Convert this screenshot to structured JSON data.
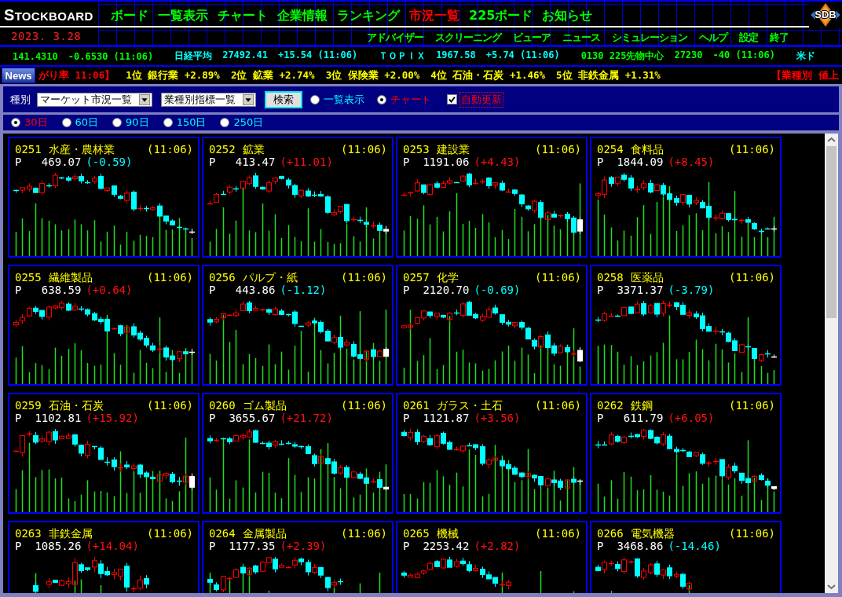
{
  "header": {
    "logo": "STOCKBOARD",
    "badge": "SDB",
    "date": "2023. 3.28",
    "nav": [
      {
        "label": "ボード",
        "selected": false
      },
      {
        "label": "一覧表示",
        "selected": false
      },
      {
        "label": "チャート",
        "selected": false
      },
      {
        "label": "企業情報",
        "selected": false
      },
      {
        "label": "ランキング",
        "selected": false
      },
      {
        "label": "市況一覧",
        "selected": true
      },
      {
        "label": "225ボード",
        "selected": false
      },
      {
        "label": "お知らせ",
        "selected": false
      }
    ],
    "subnav": [
      "アドバイザー",
      "スクリーニング",
      "ビューア",
      "ニュース",
      "シミュレーション",
      "ヘルプ",
      "設定",
      "終了"
    ]
  },
  "ticker": [
    {
      "value": "141.4310",
      "change": "-0.6530 (11:06)",
      "color": "#00ff00"
    },
    {
      "name": "日経平均",
      "value": "27492.41",
      "change": "+15.54 (11:06)",
      "color": "#00ffff"
    },
    {
      "name": "ＴＯＰＩＸ",
      "value": "1967.58",
      "change": "+5.74 (11:06)",
      "color": "#00ffff"
    },
    {
      "name": "0130 225先物中心",
      "value": "27230",
      "change": "-40 (11:06)",
      "color": "#00ff00"
    },
    {
      "name": "米ド",
      "color": "#00ffff"
    }
  ],
  "news": {
    "button": "News",
    "items": [
      {
        "kind": "heading",
        "text": "がり率 11:06】"
      },
      {
        "kind": "rank",
        "text": "1位 銀行業 +2.89%"
      },
      {
        "kind": "rank",
        "text": "2位 鉱業 +2.74%"
      },
      {
        "kind": "rank",
        "text": "3位 保険業 +2.00%"
      },
      {
        "kind": "rank",
        "text": "4位 石油・石炭 +1.46%"
      },
      {
        "kind": "rank",
        "text": "5位 非鉄金属 +1.31%"
      },
      {
        "kind": "heading",
        "text": "【業種別 値上"
      }
    ]
  },
  "controls": {
    "label": "種別",
    "selects": [
      {
        "value": "マーケット市況一覧"
      },
      {
        "value": "業種別指標一覧"
      }
    ],
    "search_button": "検索",
    "views": [
      {
        "label": "一覧表示",
        "selected": false
      },
      {
        "label": "チャート",
        "selected": true
      }
    ],
    "auto_update": {
      "label": "自動更新",
      "checked": true
    }
  },
  "periods": [
    {
      "label": "30日",
      "selected": true
    },
    {
      "label": "60日",
      "selected": false
    },
    {
      "label": "90日",
      "selected": false
    },
    {
      "label": "150日",
      "selected": false
    },
    {
      "label": "250日",
      "selected": false
    }
  ],
  "cards": [
    {
      "code": "0251",
      "name": "水産・農林業",
      "time": "(11:06)",
      "price_label": "P",
      "price": "469.07",
      "change": "(-0.59)",
      "rising": false
    },
    {
      "code": "0252",
      "name": "鉱業",
      "time": "(11:06)",
      "price_label": "P",
      "price": "413.47",
      "change": "(+11.01)",
      "rising": true
    },
    {
      "code": "0253",
      "name": "建設業",
      "time": "(11:06)",
      "price_label": "P",
      "price": "1191.06",
      "change": "(+4.43)",
      "rising": true
    },
    {
      "code": "0254",
      "name": "食料品",
      "time": "(11:06)",
      "price_label": "P",
      "price": "1844.09",
      "change": "(+8.45)",
      "rising": true
    },
    {
      "code": "0255",
      "name": "繊維製品",
      "time": "(11:06)",
      "price_label": "P",
      "price": "638.59",
      "change": "(+0.64)",
      "rising": true
    },
    {
      "code": "0256",
      "name": "パルプ・紙",
      "time": "(11:06)",
      "price_label": "P",
      "price": "443.86",
      "change": "(-1.12)",
      "rising": false
    },
    {
      "code": "0257",
      "name": "化学",
      "time": "(11:06)",
      "price_label": "P",
      "price": "2120.70",
      "change": "(-0.69)",
      "rising": false
    },
    {
      "code": "0258",
      "name": "医薬品",
      "time": "(11:06)",
      "price_label": "P",
      "price": "3371.37",
      "change": "(-3.79)",
      "rising": false
    },
    {
      "code": "0259",
      "name": "石油・石炭",
      "time": "(11:06)",
      "price_label": "P",
      "price": "1102.81",
      "change": "(+15.92)",
      "rising": true
    },
    {
      "code": "0260",
      "name": "ゴム製品",
      "time": "(11:06)",
      "price_label": "P",
      "price": "3655.67",
      "change": "(+21.72)",
      "rising": true
    },
    {
      "code": "0261",
      "name": "ガラス・土石",
      "time": "(11:06)",
      "price_label": "P",
      "price": "1121.87",
      "change": "(+3.56)",
      "rising": true
    },
    {
      "code": "0262",
      "name": "鉄鋼",
      "time": "(11:06)",
      "price_label": "P",
      "price": "611.79",
      "change": "(+6.05)",
      "rising": true
    },
    {
      "code": "0263",
      "name": "非鉄金属",
      "time": "(11:06)",
      "price_label": "P",
      "price": "1085.26",
      "change": "(+14.04)",
      "rising": true
    },
    {
      "code": "0264",
      "name": "金属製品",
      "time": "(11:06)",
      "price_label": "P",
      "price": "1177.35",
      "change": "(+2.39)",
      "rising": true
    },
    {
      "code": "0265",
      "name": "機械",
      "time": "(11:06)",
      "price_label": "P",
      "price": "2253.42",
      "change": "(+2.82)",
      "rising": true
    },
    {
      "code": "0266",
      "name": "電気機器",
      "time": "(11:06)",
      "price_label": "P",
      "price": "3468.86",
      "change": "(-14.46)",
      "rising": false
    }
  ]
}
